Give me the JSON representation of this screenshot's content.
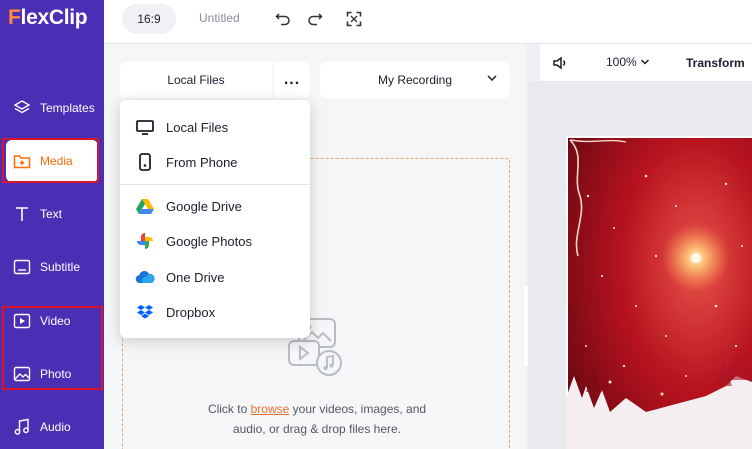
{
  "app": {
    "logo": "FlexClip"
  },
  "topbar": {
    "ratio": "16:9",
    "title": "Untitled"
  },
  "sidebar": {
    "items": [
      {
        "label": "Templates",
        "icon": "layers-icon"
      },
      {
        "label": "Media",
        "icon": "folder-plus-icon",
        "active": true
      },
      {
        "label": "Text",
        "icon": "text-icon"
      },
      {
        "label": "Subtitle",
        "icon": "subtitle-icon"
      },
      {
        "label": "Video",
        "icon": "video-icon"
      },
      {
        "label": "Photo",
        "icon": "photo-icon"
      },
      {
        "label": "Audio",
        "icon": "music-icon"
      }
    ]
  },
  "media": {
    "source_button": "Local Files",
    "more_button": "...",
    "recording_button": "My Recording",
    "dropzone": {
      "text_before": "Click to ",
      "link": "browse",
      "text_after": " your videos, images, and",
      "line2": "audio, or drag & drop files here."
    }
  },
  "dropdown": {
    "items": [
      {
        "label": "Local Files",
        "icon": "monitor-icon"
      },
      {
        "label": "From Phone",
        "icon": "phone-icon"
      },
      {
        "label": "Google Drive",
        "icon": "google-drive-icon"
      },
      {
        "label": "Google Photos",
        "icon": "google-photos-icon"
      },
      {
        "label": "One Drive",
        "icon": "onedrive-icon"
      },
      {
        "label": "Dropbox",
        "icon": "dropbox-icon"
      }
    ]
  },
  "preview": {
    "zoom": "100%",
    "transform": "Transform"
  },
  "colors": {
    "sidebar": "#4a2fb5",
    "accent": "#ff6a00",
    "highlight_box": "#d7162c",
    "dropzone_border": "#f0a060"
  }
}
